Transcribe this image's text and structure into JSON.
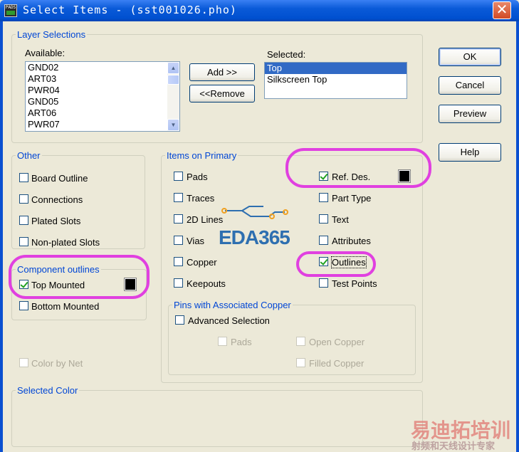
{
  "window": {
    "title": "Select Items - (sst001026.pho)",
    "icon_text": "PADS",
    "close_symbol": "✕"
  },
  "layer_selections": {
    "label": "Layer Selections",
    "available_label": "Available:",
    "available_items": [
      "GND02",
      "ART03",
      "PWR04",
      "GND05",
      "ART06",
      "PWR07"
    ],
    "selected_label": "Selected:",
    "selected_items": [
      "Top",
      "Silkscreen Top"
    ],
    "add_label": "Add >>",
    "remove_label": "<<Remove"
  },
  "buttons": {
    "ok": "OK",
    "cancel": "Cancel",
    "preview": "Preview",
    "help": "Help"
  },
  "other": {
    "label": "Other",
    "board_outline": "Board Outline",
    "connections": "Connections",
    "plated_slots": "Plated Slots",
    "non_plated_slots": "Non-plated Slots"
  },
  "component_outlines": {
    "label": "Component outlines",
    "top_mounted": "Top Mounted",
    "bottom_mounted": "Bottom Mounted",
    "top_mounted_color": "#000000"
  },
  "color_by_net": "Color by Net",
  "items_on_primary": {
    "label": "Items on Primary",
    "pads": "Pads",
    "traces": "Traces",
    "lines_2d": "2D Lines",
    "vias": "Vias",
    "copper": "Copper",
    "keepouts": "Keepouts",
    "ref_des": "Ref. Des.",
    "ref_des_color": "#000000",
    "part_type": "Part Type",
    "text": "Text",
    "attributes": "Attributes",
    "outlines": "Outlines",
    "test_points": "Test Points"
  },
  "pins_copper": {
    "label": "Pins with Associated Copper",
    "advanced_selection": "Advanced Selection",
    "pads": "Pads",
    "open_copper": "Open Copper",
    "filled_copper": "Filled Copper"
  },
  "selected_color": {
    "label": "Selected Color"
  },
  "watermark": {
    "logo": "EDA365",
    "cn_title": "易迪拓培训",
    "cn_subtitle": "射频和天线设计专家"
  },
  "colors": {
    "highlight": "#e040e0",
    "group_label": "#0046d5",
    "selection": "#316ac5"
  }
}
